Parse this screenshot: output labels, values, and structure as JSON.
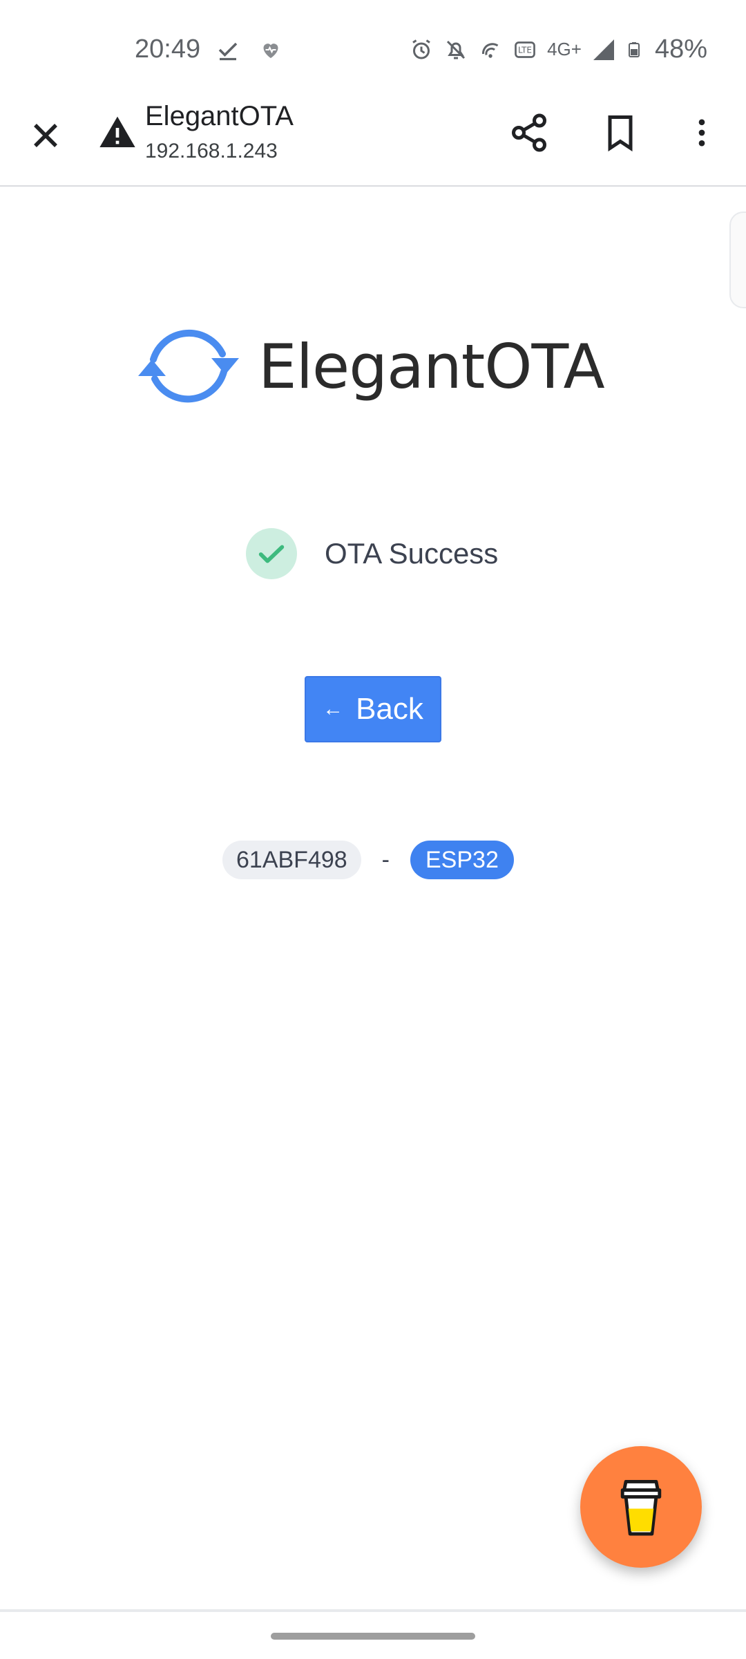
{
  "status_bar": {
    "time": "20:49",
    "network": "4G+",
    "battery": "48%"
  },
  "browser": {
    "title": "ElegantOTA",
    "url": "192.168.1.243"
  },
  "page": {
    "logo_text": "ElegantOTA",
    "status_text": "OTA Success",
    "back_button": {
      "arrow": "←",
      "label": "Back"
    },
    "build_id": "61ABF498",
    "separator": "-",
    "chip": "ESP32"
  },
  "icons": {
    "close": "close-icon",
    "warning": "warning-icon",
    "share": "share-icon",
    "bookmark": "bookmark-icon",
    "more": "more-vert-icon",
    "logo": "refresh-arrows-icon",
    "success": "check-icon",
    "coffee": "coffee-cup-icon"
  },
  "colors": {
    "accent": "#4285f4",
    "success_bg": "#cdeee0",
    "success_check": "#3dba7e",
    "fab": "#ff813f"
  }
}
